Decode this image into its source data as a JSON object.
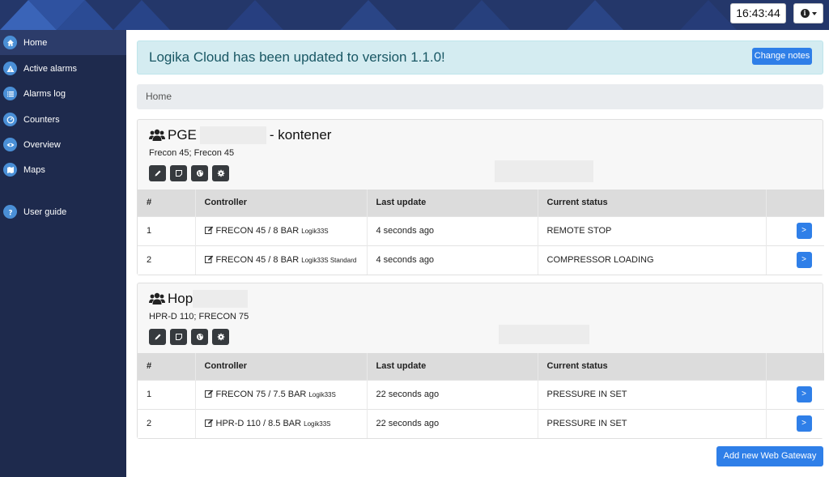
{
  "header": {
    "time": "16:43:44",
    "info_icon": "info-icon",
    "brand_color": "#24376a"
  },
  "sidebar": {
    "items": [
      {
        "label": "Home",
        "icon": "home-icon",
        "active": true
      },
      {
        "label": "Active alarms",
        "icon": "warning-icon"
      },
      {
        "label": "Alarms log",
        "icon": "list-icon"
      },
      {
        "label": "Counters",
        "icon": "gauge-icon"
      },
      {
        "label": "Overview",
        "icon": "eye-icon"
      },
      {
        "label": "Maps",
        "icon": "map-icon"
      },
      {
        "label": "User guide",
        "icon": "question-icon"
      }
    ]
  },
  "alert": {
    "message": "Logika Cloud has been updated to version 1.1.0!",
    "button": "Change notes"
  },
  "breadcrumb": "Home",
  "table_headers": [
    "#",
    "Controller",
    "Last update",
    "Current status"
  ],
  "groups": [
    {
      "title_prefix": "PGE",
      "title_suffix": "- kontener",
      "subtitle": "Frecon 45; Frecon 45",
      "rows": [
        {
          "num": "1",
          "controller": "FRECON 45 / 8 BAR",
          "model": "Logik33S",
          "last_update": "4 seconds ago",
          "status": "REMOTE STOP",
          "action": ">"
        },
        {
          "num": "2",
          "controller": "FRECON 45 / 8 BAR",
          "model": "Logik33S Standard",
          "last_update": "4 seconds ago",
          "status": "COMPRESSOR LOADING",
          "action": ">"
        }
      ]
    },
    {
      "title_prefix": "Hop",
      "title_suffix": "",
      "subtitle": "HPR-D 110; FRECON 75",
      "rows": [
        {
          "num": "1",
          "controller": "FRECON 75 / 7.5 BAR",
          "model": "Logik33S",
          "last_update": "22 seconds ago",
          "status": "PRESSURE IN SET",
          "action": ">"
        },
        {
          "num": "2",
          "controller": "HPR-D 110 / 8.5 BAR",
          "model": "Logik33S",
          "last_update": "22 seconds ago",
          "status": "PRESSURE IN SET",
          "action": ">"
        }
      ]
    }
  ],
  "add_gateway": "Add new Web Gateway"
}
